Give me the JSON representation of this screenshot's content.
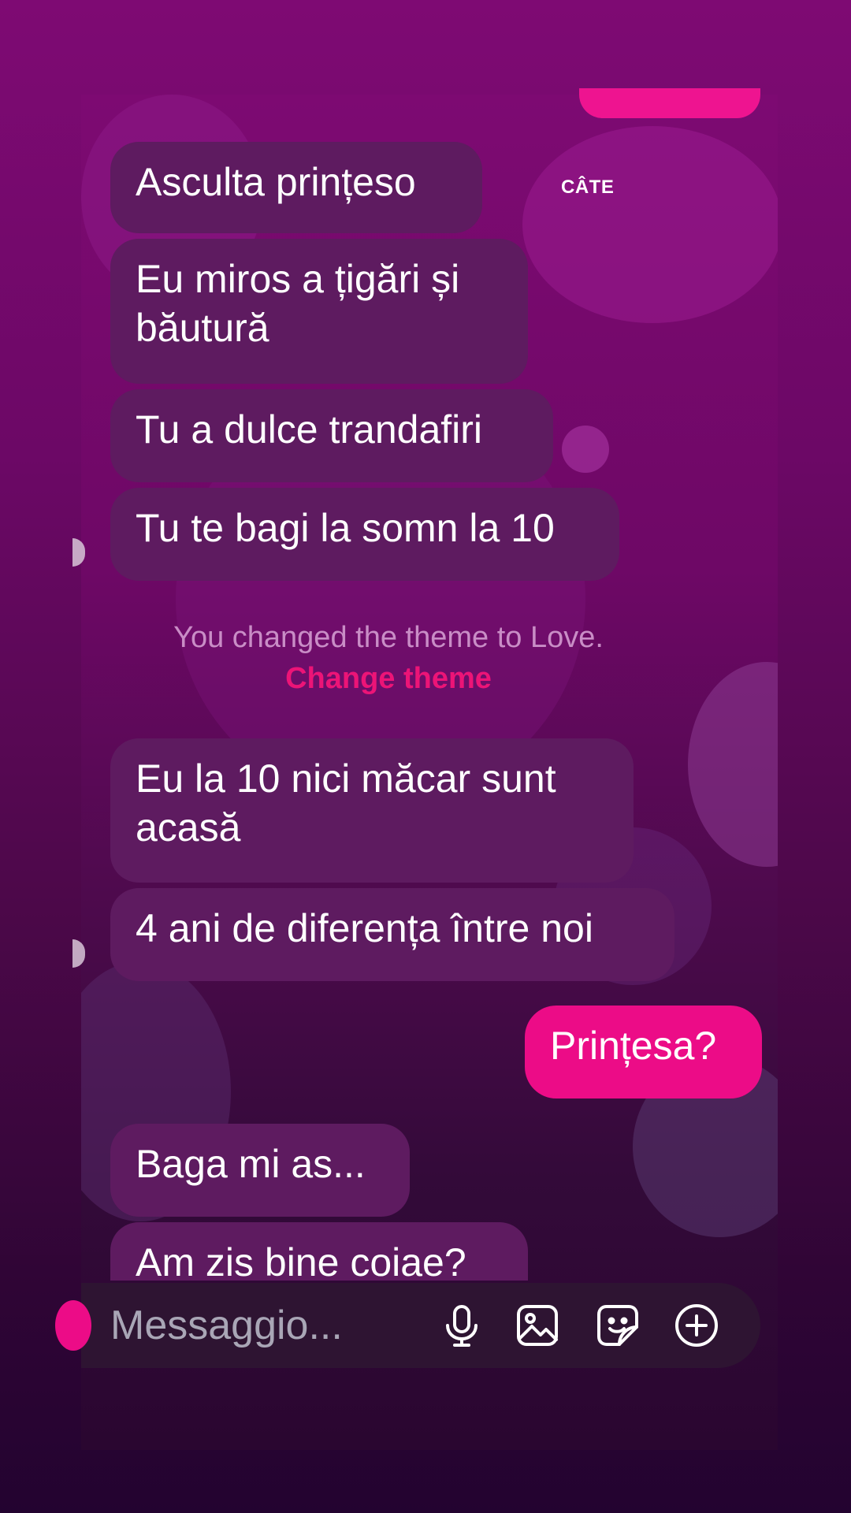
{
  "header": {
    "corner_label": "CÂTE"
  },
  "messages": [
    {
      "sender": "them",
      "text": "Asculta prințeso"
    },
    {
      "sender": "them",
      "text": "Eu miros a țigări și băutură"
    },
    {
      "sender": "them",
      "text": "Tu a dulce trandafiri"
    },
    {
      "sender": "them",
      "text": "Tu te bagi la somn la 10"
    },
    {
      "sender": "system",
      "text": "You changed the theme to Love.",
      "link": "Change theme"
    },
    {
      "sender": "them",
      "text": "Eu la 10 nici măcar sunt acasă"
    },
    {
      "sender": "them",
      "text": "4 ani de diferența între noi"
    },
    {
      "sender": "me",
      "text": "Prințesa?"
    },
    {
      "sender": "them",
      "text": "Baga mi as..."
    },
    {
      "sender": "them",
      "text": "Am zis bine coiae?"
    }
  ],
  "composer": {
    "placeholder": "Messaggio...",
    "icons": [
      "microphone-icon",
      "image-icon",
      "sticker-icon",
      "plus-circle-icon"
    ]
  },
  "colors": {
    "incoming_bubble": "#5e1b60",
    "outgoing_bubble": "#ec0c87",
    "system_text": "#c98dc6",
    "system_link": "#ec1477",
    "composer_bg": "#2e1432"
  }
}
